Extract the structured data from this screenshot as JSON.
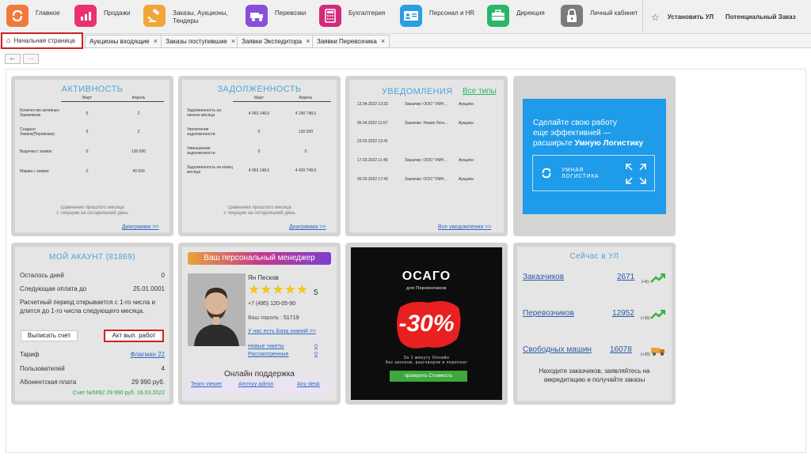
{
  "topnav": {
    "items": [
      {
        "label": "Главное",
        "icon": "home-logo-icon",
        "color": "#f07a3a"
      },
      {
        "label": "Продажи",
        "icon": "sales-chart-icon",
        "color": "#e8336e"
      },
      {
        "label": "Заказы, Аукционы, Тендеры",
        "icon": "gavel-icon",
        "color": "#f1a63a"
      },
      {
        "label": "Перевозки",
        "icon": "truck-icon",
        "color": "#8a4fd8"
      },
      {
        "label": "Бухгалтерия",
        "icon": "calculator-icon",
        "color": "#d42a7a"
      },
      {
        "label": "Персонал и HR",
        "icon": "id-card-icon",
        "color": "#2b9fe0"
      },
      {
        "label": "Дирекция",
        "icon": "briefcase-icon",
        "color": "#2bb56a"
      },
      {
        "label": "Личный кабинет",
        "icon": "lock-icon",
        "color": "#7b7b7b"
      }
    ],
    "set_ul": "Установить УЛ",
    "potential_order": "Потенциальный Заказ"
  },
  "tabs": {
    "home": "Начальная страница",
    "items": [
      "Аукционы входящие",
      "Заказы поступившие",
      "Заявки Экспедитора",
      "Заявки Перевозчика"
    ],
    "close": "×"
  },
  "navigation": {
    "back": "←",
    "forward": "→"
  },
  "activity": {
    "title": "АКТИВНОСТЬ",
    "col1": "Март",
    "col2": "Апрель",
    "rows": [
      {
        "label": "Количество активных Заказчиков",
        "v1": "5",
        "v2": "2"
      },
      {
        "label": "Создано Заявок(Перевозки)",
        "v1": "5",
        "v2": "2"
      },
      {
        "label": "Выручка с заявок",
        "v1": "0",
        "v2": "130 000"
      },
      {
        "label": "Маржа с заявок",
        "v1": "0",
        "v2": "40 000"
      }
    ],
    "footnote1": "сравнение прошлого месяца",
    "footnote2": "с текущим на сегодняшний день",
    "link": "Диаграмма >>"
  },
  "debt": {
    "title": "ЗАДОЛЖЕННОСТЬ",
    "col1": "Март",
    "col2": "Апрель",
    "rows": [
      {
        "label": "Задолженность на начало месяца",
        "v1": "4 063 148,6",
        "v2": "4 290 748,6"
      },
      {
        "label": "Увеличение задолженности",
        "v1": "0",
        "v2": "130 000"
      },
      {
        "label": "Уменьшение задолженности",
        "v1": "0",
        "v2": "0"
      },
      {
        "label": "Задолженность на конец месяца",
        "v1": "4 063 148,6",
        "v2": "4 420 748,6"
      }
    ],
    "footnote1": "сравнение прошлого месяца",
    "footnote2": "с текущим на сегодняшний день",
    "link": "Диаграмма >>"
  },
  "notifications": {
    "title": "УВЕДОМЛЕНИЯ",
    "all_types": "Все типы",
    "rows": [
      {
        "date": "12.04.2022 13:33",
        "text": "Заказчик: ООО \"УМН...",
        "kind": "Аукцион"
      },
      {
        "date": "05.04.2022 11:57",
        "text": "Заказчик: Умная Логи...",
        "kind": "Аукцион"
      },
      {
        "date": "23.03.2022 13:41",
        "text": "",
        "kind": ""
      },
      {
        "date": "17.03.2022 11:49",
        "text": "Заказчик: ООО \"УМН...",
        "kind": "Аукцион"
      },
      {
        "date": "09.03.2022 17:42",
        "text": "Заказчик: ООО \"УМН...",
        "kind": "Аукцион"
      }
    ],
    "link": "Все уведомления >>"
  },
  "promo": {
    "line1": "Сделайте свою работу",
    "line2": "еще эффективней —",
    "line3": "расширьте ",
    "line3_bold": "Умную Логистику",
    "logo_line1": "УМНАЯ",
    "logo_line2": "ЛОГИСТИКА",
    "bg": "#1e9be9"
  },
  "account": {
    "title": "МОЙ АКАУНТ (81869)",
    "days_left_label": "Осталось дней",
    "days_left_value": "0",
    "next_payment_label": "Следующая оплата до",
    "next_payment_value": "25.01.0001",
    "period_text": "Расчетный период открывается с 1-го числа и длится до 1-го числа следующего месяца.",
    "invoice_button": "Выписать счет",
    "act_button": "Акт вып. работ",
    "tariff_label": "Тариф",
    "tariff_value": "Флагман 22",
    "users_label": "Пользователей",
    "users_value": "4",
    "fee_label": "Абонентская плата",
    "fee_value": "29 990 руб.",
    "invoice_note": "Счет №5692 29 990 руб. 16.03.2022"
  },
  "manager": {
    "title": "Ваш персональный менеджер",
    "name": "Ян Песков",
    "rating": "5",
    "stars": 5,
    "phone": "+7 (495) 120-05-90",
    "password_label": "Ваш пароль : ",
    "password_value": "51719",
    "kb_link": "У нас есть База знаний >>",
    "new_tickets_label": "Новые тикеты",
    "new_tickets_value": "0",
    "reviewed_label": "Рассмотренные",
    "reviewed_value": "0",
    "support_title": "Онлайн поддержка",
    "support_links": [
      "Team viewer",
      "Ammyy admin",
      "Any desk"
    ]
  },
  "osago": {
    "title": "ОСАГО",
    "subtitle": "для Перевозчиков",
    "discount": "-30%",
    "text1": "За 1 минуту Онлайн",
    "text2": "без звонков, разговоров и переплат",
    "button": "проверить Стоимость"
  },
  "now": {
    "title": "Сейчас в УЛ",
    "rows": [
      {
        "label": "Заказчиков",
        "value": "2671",
        "delta": "(+6)"
      },
      {
        "label": "Перевозчиков",
        "value": "12952",
        "delta": "(+15)"
      },
      {
        "label": "Свободных машин",
        "value": "16078",
        "delta": "(+25)"
      }
    ],
    "footer": "Находите заказчиков, заявляйтесь на аккредитацию и получайте заказы"
  }
}
